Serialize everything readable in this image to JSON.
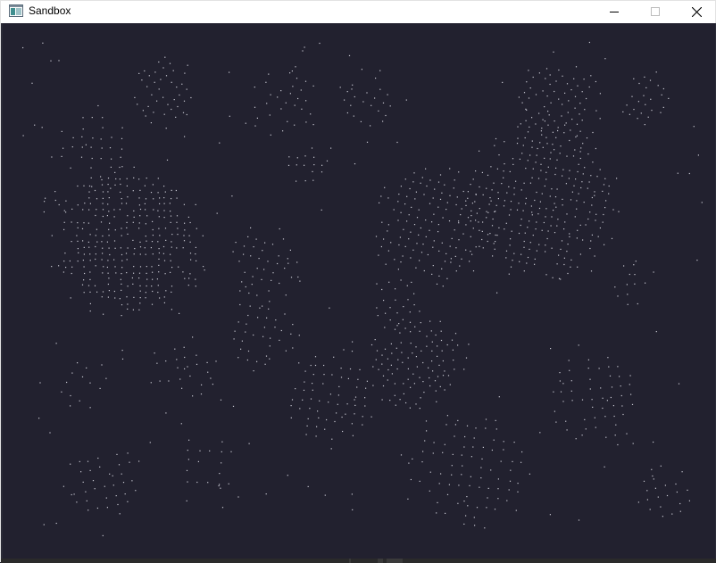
{
  "window": {
    "title": "Sandbox",
    "icon": "app-window-icon",
    "controls": {
      "minimize": "minimize-icon",
      "maximize": "maximize-icon",
      "close": "close-icon"
    }
  },
  "canvas": {
    "background": "#22212f",
    "particle_color": "#c8c8d2"
  }
}
